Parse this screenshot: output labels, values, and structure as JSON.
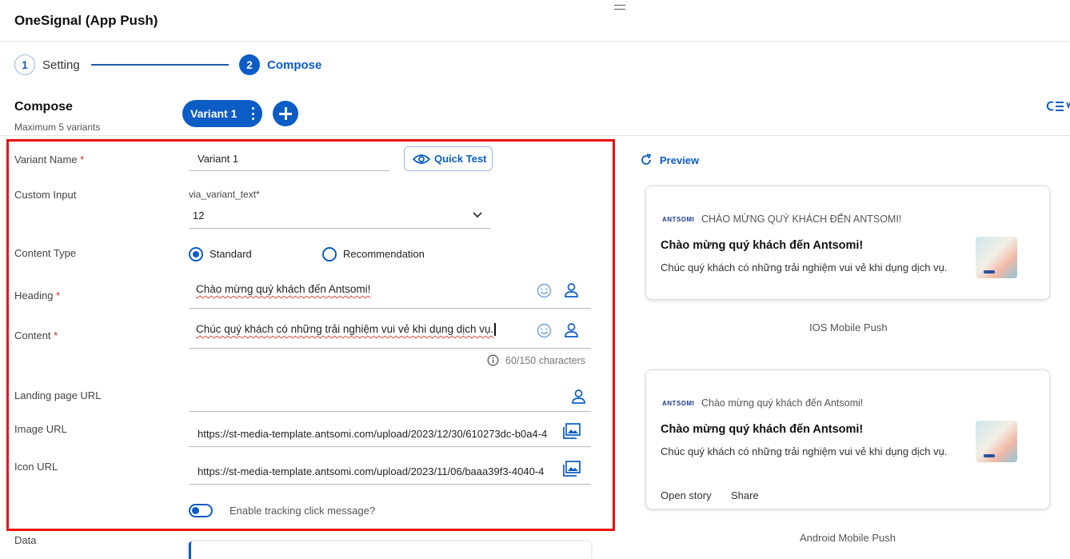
{
  "header": {
    "title": "OneSignal (App Push)"
  },
  "stepper": [
    {
      "number": "1",
      "label": "Setting"
    },
    {
      "number": "2",
      "label": "Compose"
    }
  ],
  "compose": {
    "heading": "Compose",
    "subheading": "Maximum 5 variants",
    "variant_tab": "Variant 1"
  },
  "form": {
    "variant_name_label": "Variant Name",
    "variant_name_value": "Variant 1",
    "required_mark": "*",
    "quick_test_label": "Quick Test",
    "custom_input_label": "Custom Input",
    "custom_input_field_label": "via_variant_text*",
    "custom_input_value": "12",
    "content_type_label": "Content Type",
    "content_type_options": [
      "Standard",
      "Recommendation"
    ],
    "content_type_selected": "Standard",
    "heading_label": "Heading",
    "heading_value": "Chào mừng quý khách đến Antsomi!",
    "content_label": "Content",
    "content_value": "Chúc quý khách có những trải nghiệm vui vẻ khi dụng dịch vụ.",
    "content_counter": "60/150 characters",
    "landing_label": "Landing page URL",
    "landing_value": "",
    "image_url_label": "Image URL",
    "image_url_value": "https://st-media-template.antsomi.com/upload/2023/12/30/610273dc-b0a4-4",
    "icon_url_label": "Icon URL",
    "icon_url_value": "https://st-media-template.antsomi.com/upload/2023/11/06/baaa39f3-4040-4",
    "tracking_label": "Enable tracking click message?",
    "tracking_enabled": false,
    "data_label": "Data"
  },
  "preview": {
    "label": "Preview",
    "ios": {
      "brand": "ANTSOMI",
      "app_line": "CHÀO MỪNG QUÝ KHÁCH ĐẾN ANTSOMI!",
      "title": "Chào mừng quý khách đến Antsomi!",
      "body": "Chúc quý khách có những trải nghiệm vui vẻ khi dụng dịch vụ.",
      "caption": "IOS Mobile Push"
    },
    "android": {
      "brand": "ANTSOMI",
      "app_line": "Chào mừng quý khách đến Antsomi!",
      "title": "Chào mừng quý khách đến Antsomi!",
      "body": "Chúc quý khách có những trải nghiệm vui vẻ khi dụng dịch vụ.",
      "actions": [
        "Open story",
        "Share"
      ],
      "caption": "Android Mobile Push"
    }
  },
  "colors": {
    "accent": "#0b5cc4",
    "highlight_frame": "#e11111",
    "required": "#dd2222"
  }
}
